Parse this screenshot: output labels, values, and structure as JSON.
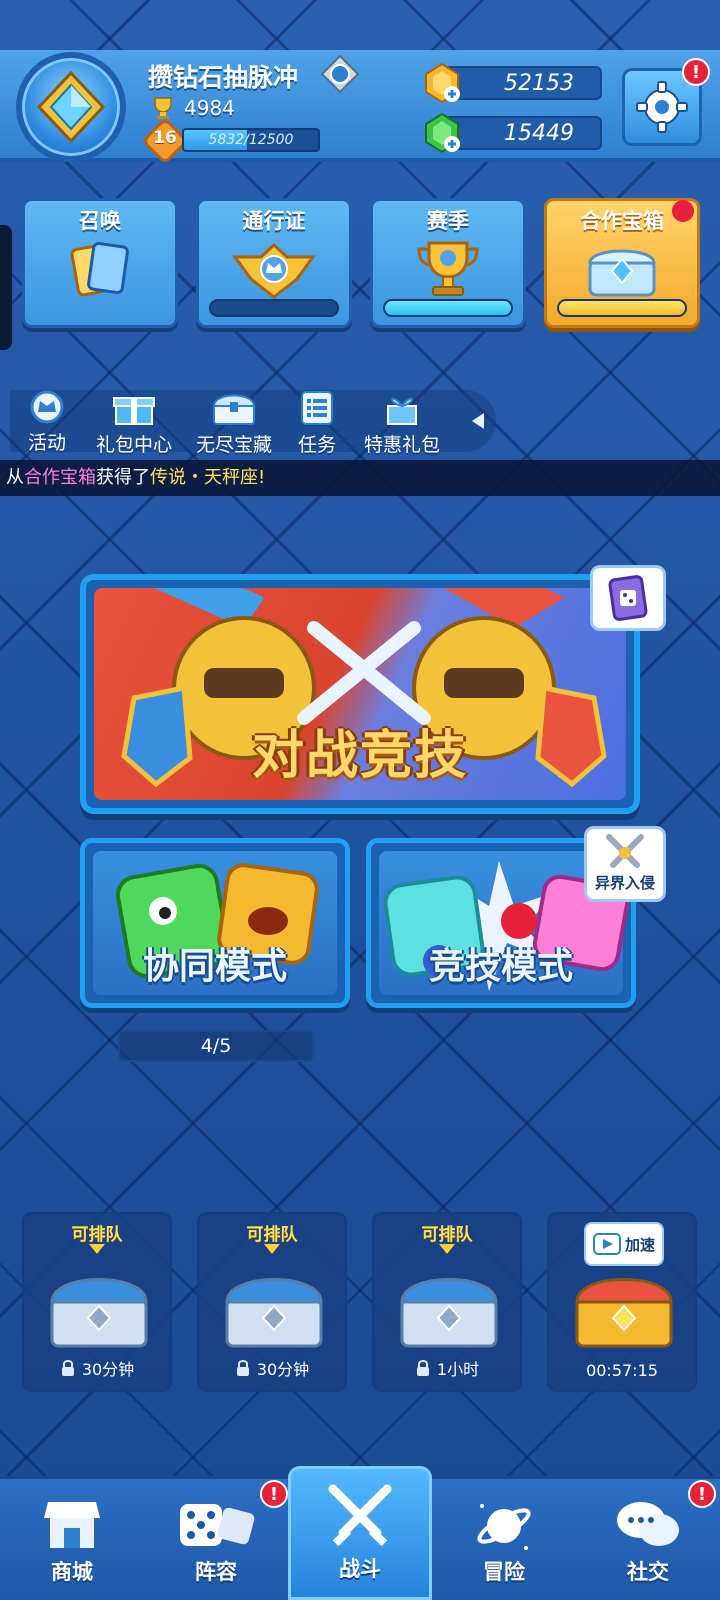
{
  "player": {
    "name": "攒钻石抽脉冲",
    "trophies": "4984",
    "level": "16",
    "xp_text": "5832/12500",
    "xp_fraction": 0.4666
  },
  "currency": {
    "gold": "52153",
    "gems": "15449"
  },
  "settings": {
    "alert": "!"
  },
  "cards": {
    "summon": {
      "label": "召唤"
    },
    "pass": {
      "label": "通行证",
      "progress": 0.0
    },
    "season": {
      "label": "赛季",
      "progress": 1.0
    },
    "coop_chest": {
      "label": "合作宝箱",
      "progress": 1.0
    }
  },
  "subnav": {
    "activity": "活动",
    "gift_center": "礼包中心",
    "endless_treasure": "无尽宝藏",
    "tasks": "任务",
    "special_pack": "特惠礼包"
  },
  "ticker": {
    "prefix": "从",
    "source": "合作宝箱",
    "middle": "获得了",
    "rarity": "传说",
    "dot": "・",
    "item": "天秤座",
    "suffix": "!"
  },
  "battle": {
    "title": "对战竞技"
  },
  "modes": {
    "coop": {
      "title": "协同模式",
      "progress": "4/5"
    },
    "pvp": {
      "title": "竞技模式"
    },
    "invasion": {
      "label": "异界入侵"
    }
  },
  "chests": [
    {
      "queue": "可排队",
      "time": "30分钟",
      "locked": true
    },
    {
      "queue": "可排队",
      "time": "30分钟",
      "locked": true
    },
    {
      "queue": "可排队",
      "time": "1小时",
      "locked": true
    },
    {
      "speedup": "加速",
      "time": "00:57:15",
      "locked": false
    }
  ],
  "bottom_nav": {
    "shop": "商城",
    "lineup": "阵容",
    "battle": "战斗",
    "adventure": "冒险",
    "social": "社交",
    "alert": "!"
  },
  "colors": {
    "accent": "#2f7fd1",
    "gold": "#ffd86b",
    "alert_red": "#e8203a",
    "ticker_pink": "#ff7fd6",
    "ticker_yellow": "#ffe15a"
  }
}
